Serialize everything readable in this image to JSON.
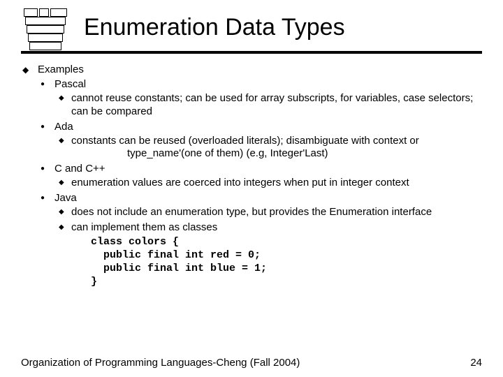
{
  "title": "Enumeration Data Types",
  "b1": "Examples",
  "pascal": {
    "label": "Pascal",
    "p1": "cannot reuse constants; can be used for array subscripts, for variables, case selectors; can be compared"
  },
  "ada": {
    "label": "Ada",
    "p1": "constants can be reused (overloaded literals); disambiguate with context or",
    "p2": "type_name'(one of them)    (e.g,  Integer'Last)"
  },
  "ccpp": {
    "label": "C and C++",
    "p1": "enumeration values are coerced into integers when put in integer context"
  },
  "java": {
    "label": "Java",
    "p1": "does not include an enumeration type, but provides the Enumeration interface",
    "p2": "can implement them as classes",
    "code": "class colors {\n  public final int red = 0;\n  public final int blue = 1;\n}"
  },
  "footer": {
    "left": "Organization of Programming Languages-Cheng (Fall 2004)",
    "right": "24"
  }
}
